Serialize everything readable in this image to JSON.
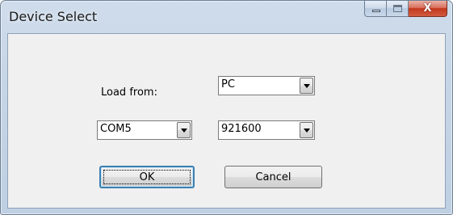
{
  "window": {
    "title": "Device Select",
    "caption": {
      "minimize_icon": "minimize-icon",
      "maximize_icon": "maximize-icon",
      "close_icon": "close-icon",
      "close_glyph": "X"
    }
  },
  "form": {
    "load_from_label": "Load from:",
    "load_from_value": "PC",
    "port_value": "COM5",
    "baud_value": "921600"
  },
  "buttons": {
    "ok_label": "OK",
    "cancel_label": "Cancel"
  },
  "colors": {
    "close_button": "#c2371d",
    "default_button_border": "#3c7fb1"
  }
}
